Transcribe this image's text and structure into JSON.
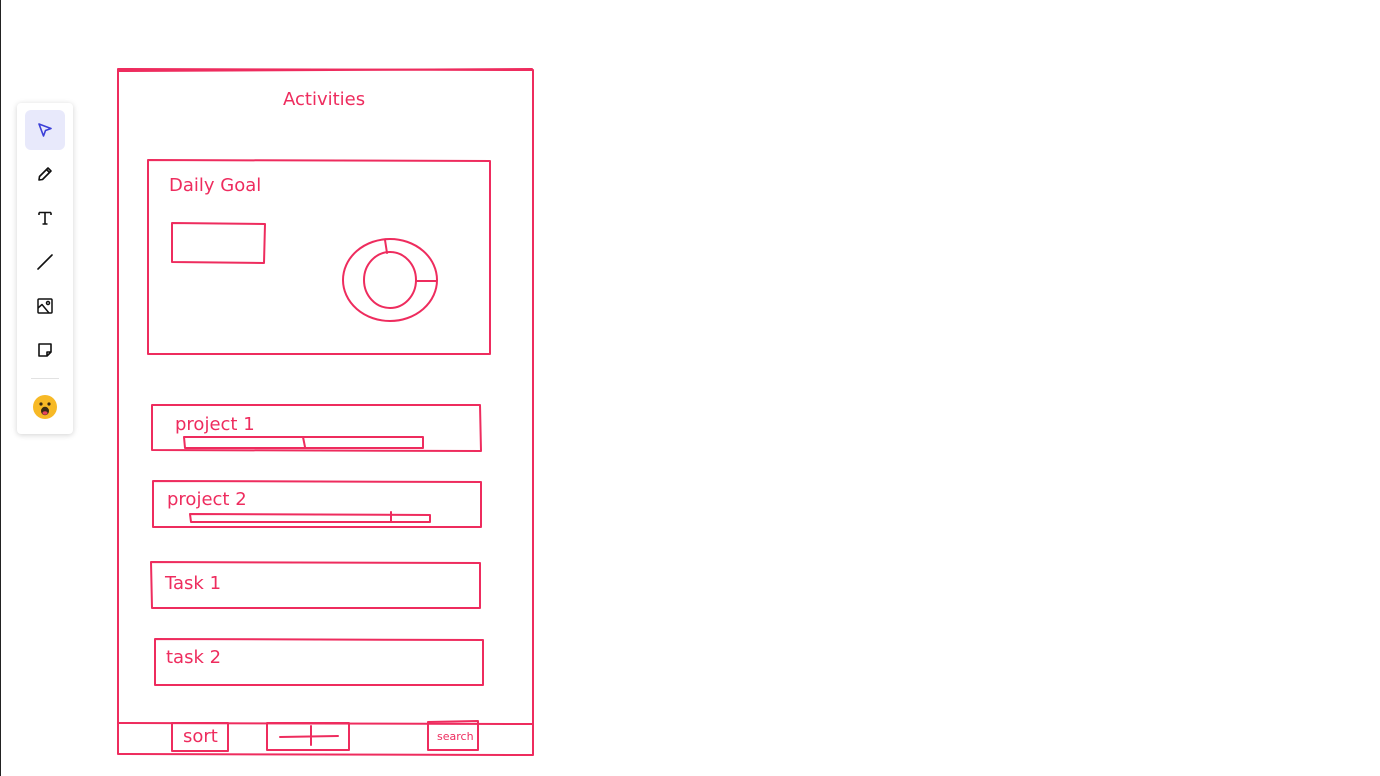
{
  "toolbar": {
    "tools": [
      {
        "name": "select",
        "icon": "cursor-icon",
        "active": true
      },
      {
        "name": "pencil",
        "icon": "pencil-icon",
        "active": false
      },
      {
        "name": "text",
        "icon": "text-icon",
        "active": false
      },
      {
        "name": "line",
        "icon": "line-icon",
        "active": false
      },
      {
        "name": "image",
        "icon": "image-icon",
        "active": false
      },
      {
        "name": "sticky-note",
        "icon": "sticky-note-icon",
        "active": false
      },
      {
        "name": "emoji",
        "icon": "emoji-icon",
        "active": false
      }
    ]
  },
  "wireframe": {
    "title": "Activities",
    "goal_card": {
      "title": "Daily Goal"
    },
    "items": [
      {
        "label": "project 1",
        "progress": 0.5
      },
      {
        "label": "project 2",
        "progress": 0.84
      },
      {
        "label": "Task 1"
      },
      {
        "label": "task 2"
      }
    ],
    "bottom_bar": {
      "sort_label": "sort",
      "search_label": "search"
    }
  },
  "colors": {
    "sketch": "#ee2c5e",
    "active_tool_bg": "#e8e9fb",
    "active_tool_icon": "#3b3fd8"
  }
}
